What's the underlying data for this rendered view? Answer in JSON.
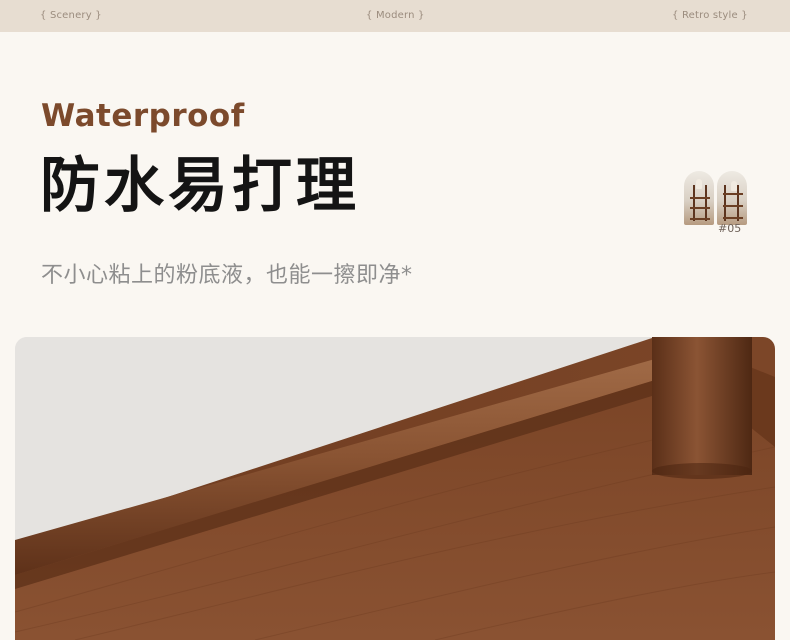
{
  "nav": {
    "items": [
      "{ Scenery }",
      "{ Modern }",
      "{ Retro style }"
    ]
  },
  "feature": {
    "eyebrow": "Waterproof",
    "title": "防水易打理",
    "subtitle": "不小心粘上的粉底液，也能一擦即净*",
    "thumbnail_label": "#05"
  },
  "colors": {
    "brand_brown": "#7c4a2c",
    "top_bar": "#e7ddd1",
    "background": "#faf7f2"
  }
}
